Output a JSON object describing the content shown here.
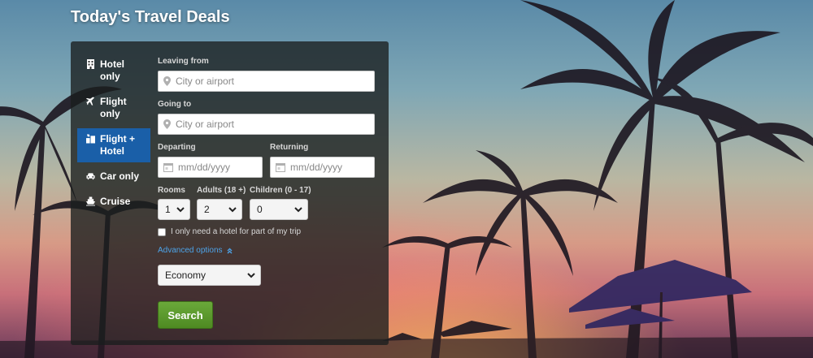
{
  "header": {
    "title": "Today's Travel Deals"
  },
  "tabs": [
    {
      "label": "Hotel only",
      "icon": "building-icon",
      "active": false
    },
    {
      "label": "Flight only",
      "icon": "airplane-icon",
      "active": false
    },
    {
      "label": "Flight + Hotel",
      "icon": "flight-hotel-icon",
      "active": true
    },
    {
      "label": "Car only",
      "icon": "car-icon",
      "active": false
    },
    {
      "label": "Cruise",
      "icon": "ship-icon",
      "active": false
    }
  ],
  "form": {
    "leaving_label": "Leaving from",
    "leaving_placeholder": "City or airport",
    "going_label": "Going to",
    "going_placeholder": "City or airport",
    "departing_label": "Departing",
    "departing_placeholder": "mm/dd/yyyy",
    "returning_label": "Returning",
    "returning_placeholder": "mm/dd/yyyy",
    "rooms_label": "Rooms",
    "rooms_value": "1",
    "adults_label": "Adults (18 +)",
    "adults_value": "2",
    "children_label": "Children (0 - 17)",
    "children_value": "0",
    "partial_hotel_label": "I only need a hotel for part of my trip",
    "partial_hotel_checked": false,
    "advanced_label": "Advanced options",
    "cabin_value": "Economy",
    "search_label": "Search"
  },
  "colors": {
    "active_tab": "#1a5fa8",
    "search_button": "#5a9a2e",
    "link": "#4da3e8"
  }
}
